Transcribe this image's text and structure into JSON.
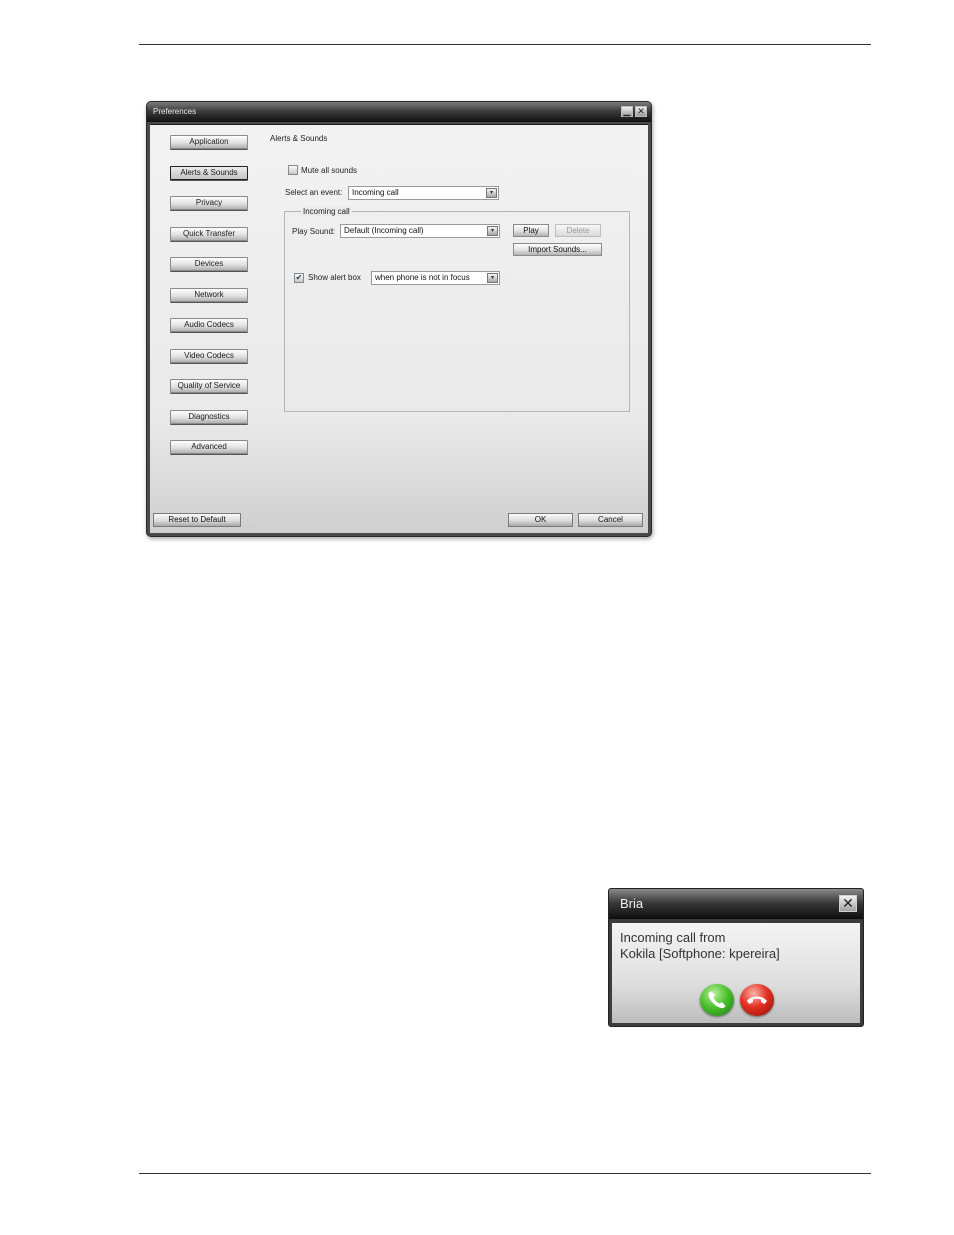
{
  "preferences": {
    "window_title": "Preferences",
    "minimize_glyph": "▁",
    "close_glyph": "✕",
    "nav_items": [
      {
        "label": "Application",
        "selected": false
      },
      {
        "label": "Alerts & Sounds",
        "selected": true
      },
      {
        "label": "Privacy",
        "selected": false
      },
      {
        "label": "Quick Transfer",
        "selected": false
      },
      {
        "label": "Devices",
        "selected": false
      },
      {
        "label": "Network",
        "selected": false
      },
      {
        "label": "Audio Codecs",
        "selected": false
      },
      {
        "label": "Video Codecs",
        "selected": false
      },
      {
        "label": "Quality of Service",
        "selected": false
      },
      {
        "label": "Diagnostics",
        "selected": false
      },
      {
        "label": "Advanced",
        "selected": false
      }
    ],
    "panel": {
      "heading": "Alerts & Sounds",
      "mute_all_label": "Mute all sounds",
      "mute_all_checked": false,
      "select_event_label": "Select an event:",
      "select_event_value": "Incoming call",
      "group_title": "Incoming call",
      "play_sound_label": "Play Sound:",
      "play_sound_value": "Default (Incoming call)",
      "play_button": "Play",
      "delete_button": "Delete",
      "import_button": "Import Sounds...",
      "show_alert_label": "Show alert box",
      "show_alert_checked": true,
      "show_alert_value": "when phone is not in focus",
      "dropdown_arrow": "▾",
      "check_glyph": "✔"
    },
    "footer": {
      "reset_button": "Reset to Default",
      "ok_button": "OK",
      "cancel_button": "Cancel"
    }
  },
  "bria_popup": {
    "title": "Bria",
    "close_glyph": "✕",
    "message_line1": "Incoming call from",
    "message_line2": "Kokila [Softphone: kpereira]",
    "answer_color": "#3fb526",
    "decline_color": "#d8261b"
  }
}
